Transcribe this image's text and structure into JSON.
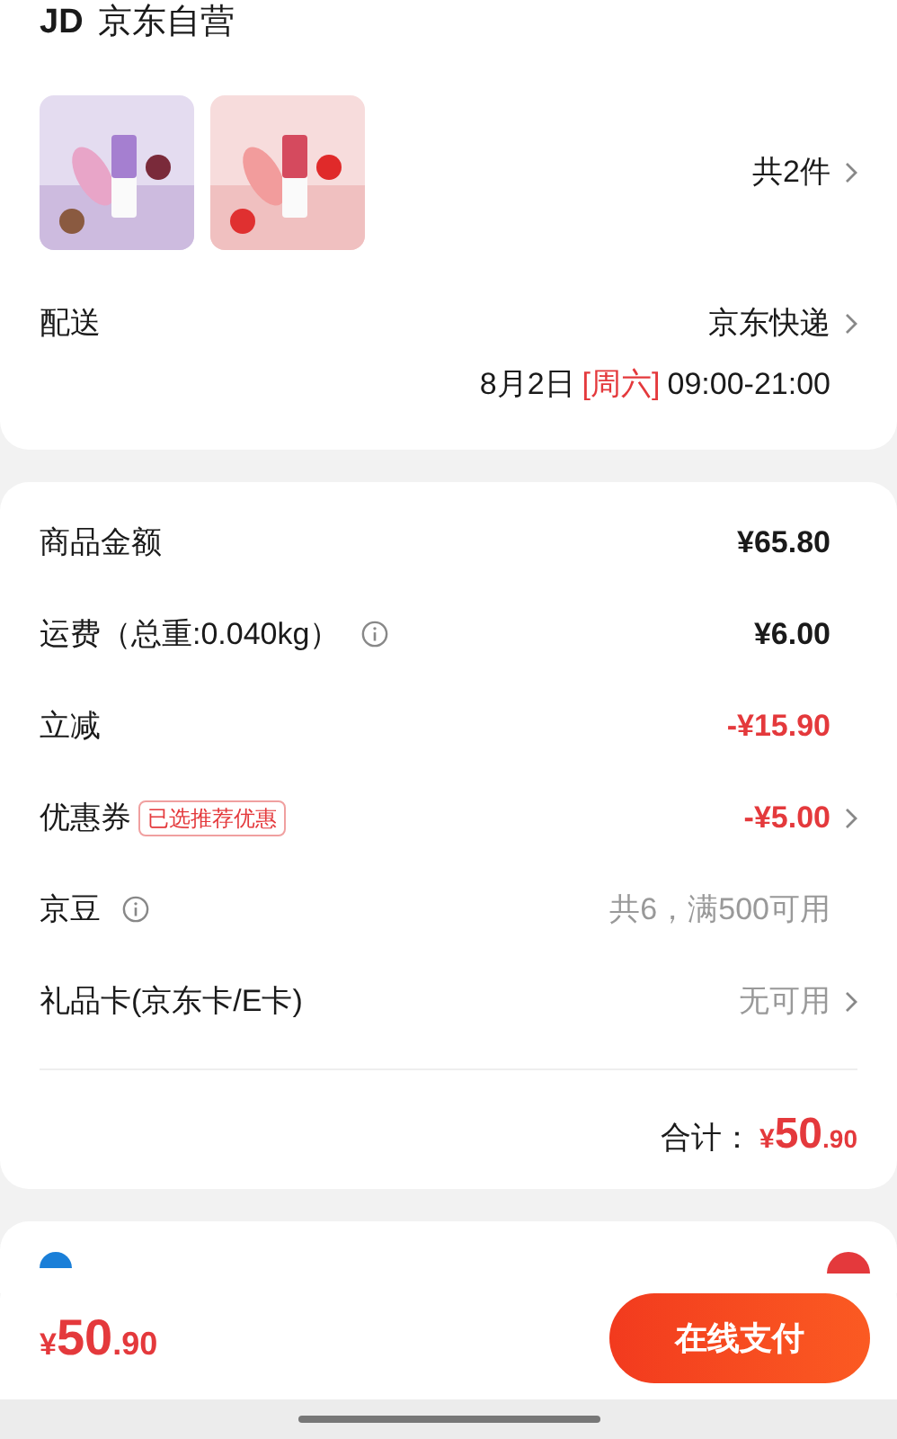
{
  "shop": {
    "logo": "JD",
    "name": "京东自营"
  },
  "products": {
    "count": "共2件"
  },
  "delivery": {
    "label": "配送",
    "carrier": "京东快递",
    "date": "8月2日",
    "weekday": "[周六]",
    "time": "09:00-21:00"
  },
  "fees": [
    {
      "label": "商品金额",
      "info": false,
      "value": "¥65.80",
      "kind": "amount",
      "chevron": false
    },
    {
      "label": "运费（总重:0.040kg）",
      "info": true,
      "value": "¥6.00",
      "kind": "amount",
      "chevron": false
    },
    {
      "label": "立减",
      "info": false,
      "value": "-¥15.90",
      "kind": "discount",
      "chevron": false
    },
    {
      "label": "优惠券",
      "info": false,
      "tag": "已选推荐优惠",
      "value": "-¥5.00",
      "kind": "discount",
      "chevron": true
    },
    {
      "label": "京豆",
      "info": true,
      "value": "共6，满500可用",
      "kind": "muted",
      "chevron": false
    },
    {
      "label": "礼品卡(京东卡/E卡)",
      "info": false,
      "value": "无可用",
      "kind": "muted",
      "chevron": true
    }
  ],
  "total": {
    "label": "合计：",
    "currency": "¥",
    "integer": "50",
    "decimal": ".90"
  },
  "bottom_bar": {
    "currency": "¥",
    "integer": "50",
    "decimal": ".90",
    "pay_button": "在线支付"
  }
}
